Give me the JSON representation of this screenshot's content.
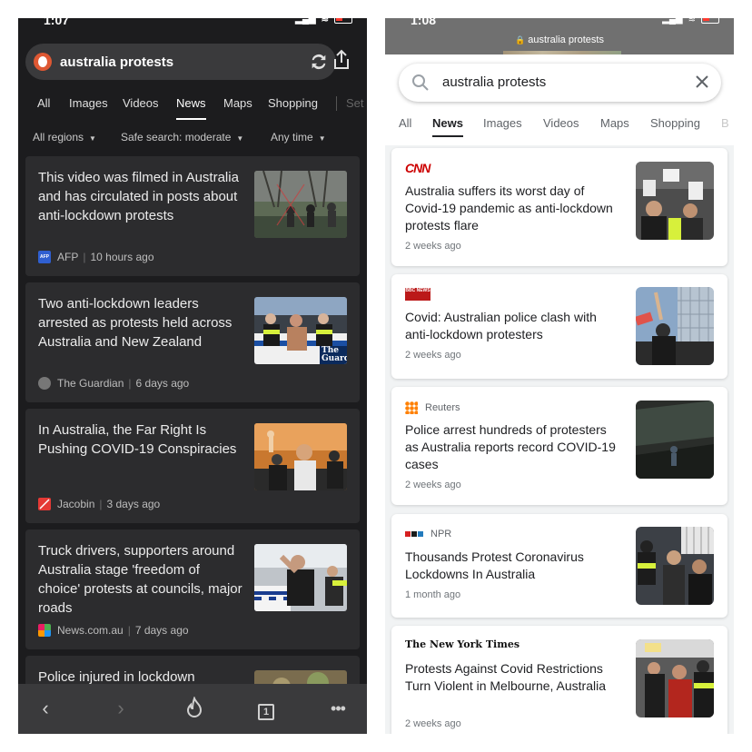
{
  "left": {
    "status_time": "1:07",
    "search_query": "australia protests",
    "tabs": [
      {
        "label": "All"
      },
      {
        "label": "Images"
      },
      {
        "label": "Videos"
      },
      {
        "label": "News"
      },
      {
        "label": "Maps"
      },
      {
        "label": "Shopping"
      },
      {
        "label": "Set"
      }
    ],
    "filters": [
      {
        "label": "All regions"
      },
      {
        "label": "Safe search: moderate"
      },
      {
        "label": "Any time"
      }
    ],
    "results": [
      {
        "title": "This video was filmed in Australia and has circulated in posts about anti-lockdown protests",
        "source": "AFP",
        "time": "10 hours ago"
      },
      {
        "title": "Two anti-lockdown leaders arrested as protests held across Australia and New Zealand",
        "source": "The Guardian",
        "time": "6 days ago"
      },
      {
        "title": "In Australia, the Far Right Is Pushing COVID-19 Conspiracies",
        "source": "Jacobin",
        "time": "3 days ago"
      },
      {
        "title": "Truck drivers, supporters around Australia stage 'freedom of choice' protests at councils, major roads",
        "source": "News.com.au",
        "time": "7 days ago"
      },
      {
        "title": "Police injured in lockdown"
      }
    ],
    "afp_logo": "AFP",
    "tab_count": "1",
    "guardian_thumb_text": "The Guard"
  },
  "right": {
    "status_time": "1:08",
    "url": "australia protests",
    "search_query": "australia protests",
    "tabs": [
      {
        "label": "All"
      },
      {
        "label": "News"
      },
      {
        "label": "Images"
      },
      {
        "label": "Videos"
      },
      {
        "label": "Maps"
      },
      {
        "label": "Shopping"
      },
      {
        "label": "B"
      }
    ],
    "results": [
      {
        "source_logo": "CNN",
        "title": "Australia suffers its worst day of Covid-19 pandemic as anti-lockdown protests flare",
        "time": "2 weeks ago"
      },
      {
        "source_logo": "BBC NEWS",
        "title": "Covid: Australian police clash with anti-lockdown protesters",
        "time": "2 weeks ago"
      },
      {
        "source": "Reuters",
        "title": "Police arrest hundreds of protesters as Australia reports record COVID-19 cases",
        "time": "2 weeks ago"
      },
      {
        "source": "NPR",
        "title": "Thousands Protest Coronavirus Lockdowns In Australia",
        "time": "1 month ago"
      },
      {
        "source_logo": "The New York Times",
        "title": "Protests Against Covid Restrictions Turn Violent in Melbourne, Australia",
        "time": "2 weeks ago"
      }
    ]
  },
  "colors": {
    "ddg_orange": "#de5833",
    "cnn_red": "#cc0000",
    "bbc_red": "#bb1919",
    "reuters_orange": "#ff8000"
  },
  "icons": [
    "ddg-logo-icon",
    "reload-icon",
    "share-icon",
    "back-icon",
    "forward-icon",
    "fire-icon",
    "tabs-icon",
    "more-icon",
    "search-icon",
    "clear-icon",
    "lock-icon"
  ]
}
